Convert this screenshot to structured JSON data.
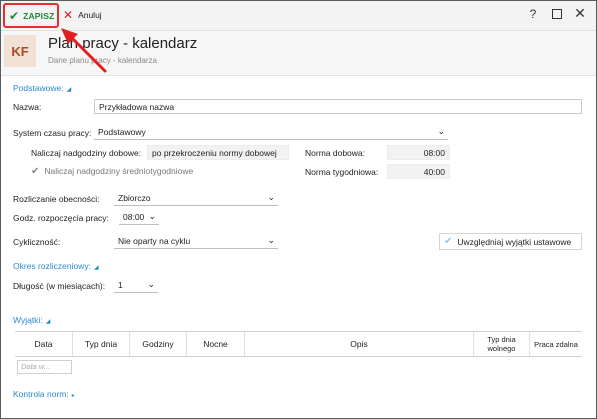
{
  "toolbar": {
    "save_label": "ZAPISZ",
    "cancel_label": "Anuluj",
    "help_glyph": "?",
    "close_glyph": "✕"
  },
  "header": {
    "avatar_text": "KF",
    "title": "Plan pracy - kalendarz",
    "subtitle": "Dane planu pracy - kalendarza"
  },
  "sections": {
    "basic": "Podstawowe:",
    "period": "Okres rozliczeniowy:",
    "exceptions": "Wyjątki:",
    "norms": "Kontrola norm:"
  },
  "form": {
    "name_label": "Nazwa:",
    "name_value": "Przykładowa nazwa",
    "system_label": "System czasu pracy:",
    "system_value": "Podstawowy",
    "overtime_daily_label": "Naliczaj nadgodziny dobowe:",
    "overtime_daily_value": "po przekroczeniu normy dobowej",
    "overtime_weekly_label": "Naliczaj nadgodziny średniotygodniowe",
    "norm_daily_label": "Norma dobowa:",
    "norm_daily_value": "08:00",
    "norm_weekly_label": "Norma tygodniowa:",
    "norm_weekly_value": "40:00",
    "settlement_label": "Rozliczanie obecności:",
    "settlement_value": "Zbiorczo",
    "start_hour_label": "Godz. rozpoczęcia pracy:",
    "start_hour_value": "08:00",
    "cyclicity_label": "Cykliczność:",
    "cyclicity_value": "Nie oparty na cyklu",
    "statutory_exceptions_button": "Uwzględniaj wyjątki ustawowe",
    "length_label": "Długość (w miesiącach):",
    "length_value": "1"
  },
  "exceptions_table": {
    "columns": [
      "Data",
      "Typ dnia",
      "Godziny",
      "Nocne",
      "Opis",
      "Typ dnia wolnego",
      "Praca zdalna"
    ],
    "date_filter_placeholder": "Data w..."
  },
  "colors": {
    "accent": "#2b8acb",
    "save_green": "#1f8a3a",
    "highlight_red": "#e03030",
    "avatar_bg": "#f2e2d6",
    "avatar_fg": "#b04a1e"
  }
}
